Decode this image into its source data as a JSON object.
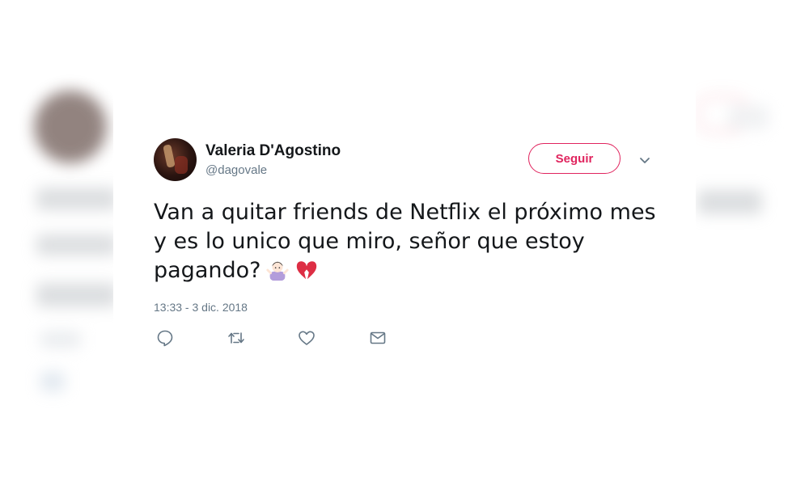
{
  "tweet": {
    "display_name": "Valeria D'Agostino",
    "handle": "@dagovale",
    "follow_label": "Seguir",
    "text_lines": [
      "Van a quitar friends de Netflix el próximo mes",
      "y es lo unico que miro, señor que estoy",
      "pagando?"
    ],
    "timestamp": "13:33 - 3 dic. 2018",
    "emojis": [
      "person-shrugging-emoji",
      "broken-heart-emoji"
    ]
  },
  "actions": [
    "reply-icon",
    "retweet-icon",
    "like-icon",
    "direct-message-icon"
  ],
  "colors": {
    "accent": "#e0245e",
    "text": "#14171a",
    "secondary": "#657786"
  }
}
